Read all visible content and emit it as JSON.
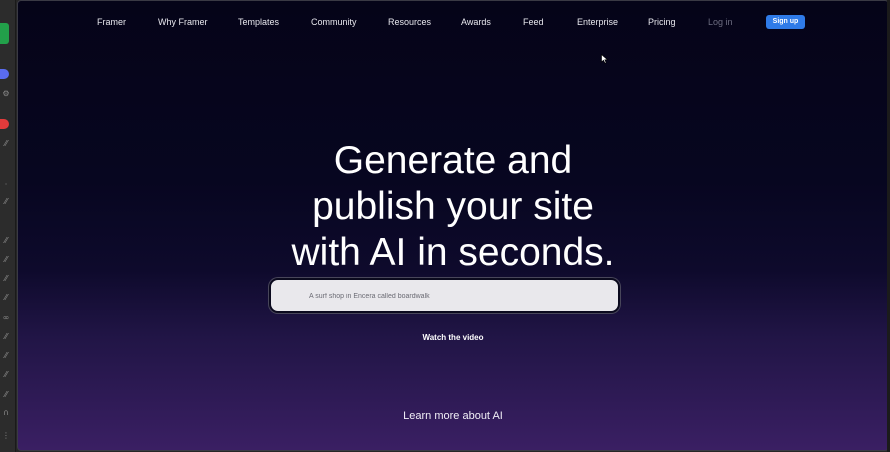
{
  "editor_strip": {
    "icons": [
      "gear-icon",
      "link-icon",
      "link-icon",
      "link-icon",
      "link-icon",
      "link-icon",
      "link-icon",
      "link-icon",
      "link-icon",
      "link-icon",
      "link-icon",
      "link-icon",
      "headphones-icon"
    ],
    "colors": {
      "run_button": "#22a04a",
      "badge_blue": "#5a6cf0",
      "badge_red": "#e23b3b"
    }
  },
  "nav": {
    "items": [
      {
        "label": "Framer"
      },
      {
        "label": "Why Framer"
      },
      {
        "label": "Templates"
      },
      {
        "label": "Community"
      },
      {
        "label": "Resources"
      },
      {
        "label": "Awards"
      },
      {
        "label": "Feed"
      },
      {
        "label": "Enterprise"
      },
      {
        "label": "Pricing"
      }
    ],
    "login_label": "Log in",
    "signup_label": "Sign up"
  },
  "hero": {
    "headline_lines": [
      "Generate and",
      "publish your site",
      "with AI in seconds."
    ],
    "prompt_placeholder": "A surf shop in Encera called boardwalk",
    "watch_video_label": "Watch the video",
    "learn_more_label": "Learn more about AI"
  },
  "colors": {
    "accent": "#2f7be8",
    "background_top": "#050418",
    "background_bottom": "#3a1f63",
    "input_bg": "#e9e8ec"
  }
}
